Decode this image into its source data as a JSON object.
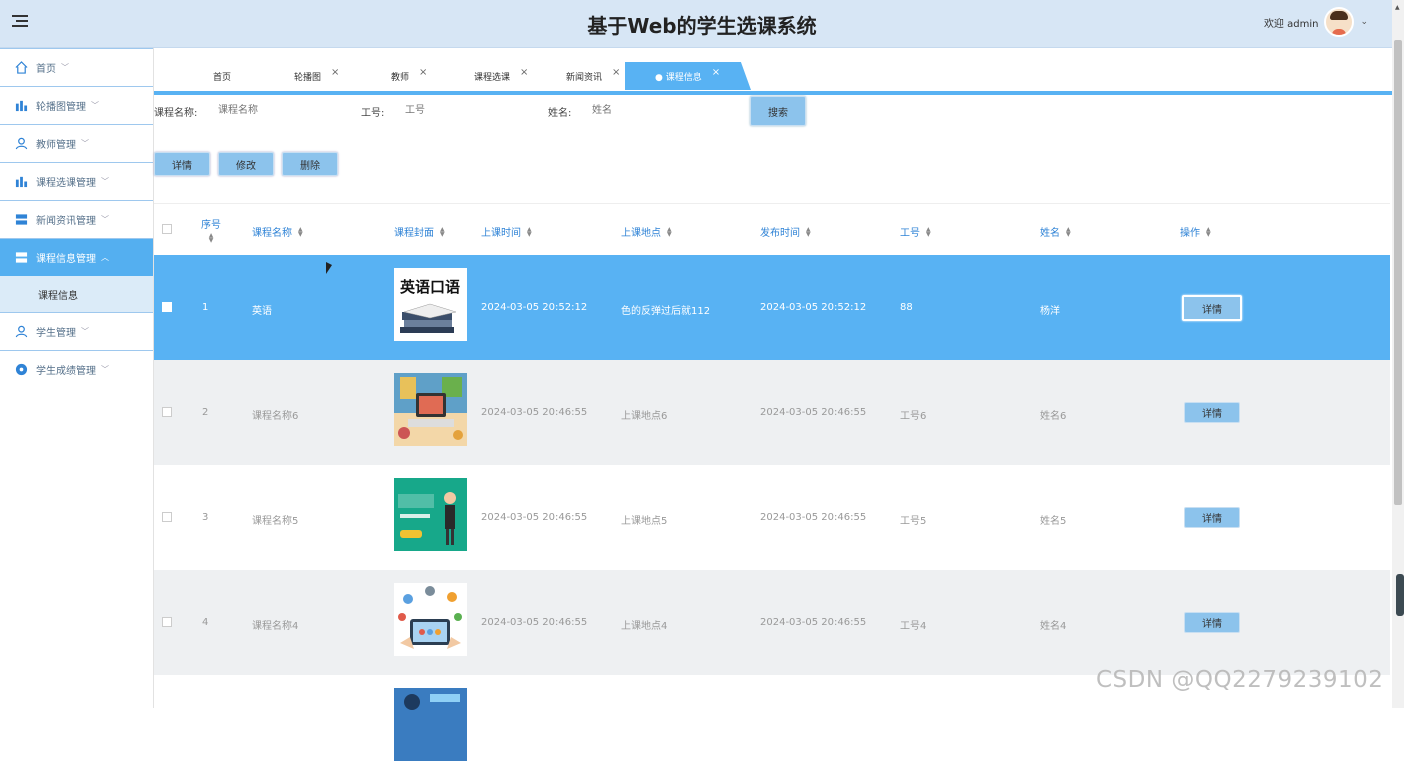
{
  "header": {
    "title": "基于Web的学生选课系统",
    "welcome": "欢迎 admin"
  },
  "sidebar": {
    "items": [
      {
        "label": "首页"
      },
      {
        "label": "轮播图管理"
      },
      {
        "label": "教师管理"
      },
      {
        "label": "课程选课管理"
      },
      {
        "label": "新闻资讯管理"
      },
      {
        "label": "课程信息管理"
      },
      {
        "label": "学生管理"
      },
      {
        "label": "学生成绩管理"
      }
    ],
    "active_sub": "课程信息"
  },
  "tabs": [
    {
      "label": "首页"
    },
    {
      "label": "轮播图"
    },
    {
      "label": "教师"
    },
    {
      "label": "课程选课"
    },
    {
      "label": "新闻资讯"
    },
    {
      "label": "● 课程信息"
    }
  ],
  "search": {
    "course_label": "课程名称:",
    "course_placeholder": "课程名称",
    "id_label": "工号:",
    "id_placeholder": "工号",
    "name_label": "姓名:",
    "name_placeholder": "姓名",
    "button": "搜索"
  },
  "actions": {
    "detail": "详情",
    "edit": "修改",
    "delete": "删除"
  },
  "table": {
    "headers": [
      "序号",
      "课程名称",
      "课程封面",
      "上课时间",
      "上课地点",
      "发布时间",
      "工号",
      "姓名",
      "操作"
    ],
    "rows": [
      {
        "no": "1",
        "course": "英语",
        "time": "2024-03-05 20:52:12",
        "place": "色的反弹过后就112",
        "publish": "2024-03-05 20:52:12",
        "id": "88",
        "name": "杨洋",
        "action": "详情",
        "cover_text": "英语口语"
      },
      {
        "no": "2",
        "course": "课程名称6",
        "time": "2024-03-05 20:46:55",
        "place": "上课地点6",
        "publish": "2024-03-05 20:46:55",
        "id": "工号6",
        "name": "姓名6",
        "action": "详情"
      },
      {
        "no": "3",
        "course": "课程名称5",
        "time": "2024-03-05 20:46:55",
        "place": "上课地点5",
        "publish": "2024-03-05 20:46:55",
        "id": "工号5",
        "name": "姓名5",
        "action": "详情"
      },
      {
        "no": "4",
        "course": "课程名称4",
        "time": "2024-03-05 20:46:55",
        "place": "上课地点4",
        "publish": "2024-03-05 20:46:55",
        "id": "工号4",
        "name": "姓名4",
        "action": "详情"
      }
    ]
  },
  "watermark": "CSDN @QQ2279239102"
}
